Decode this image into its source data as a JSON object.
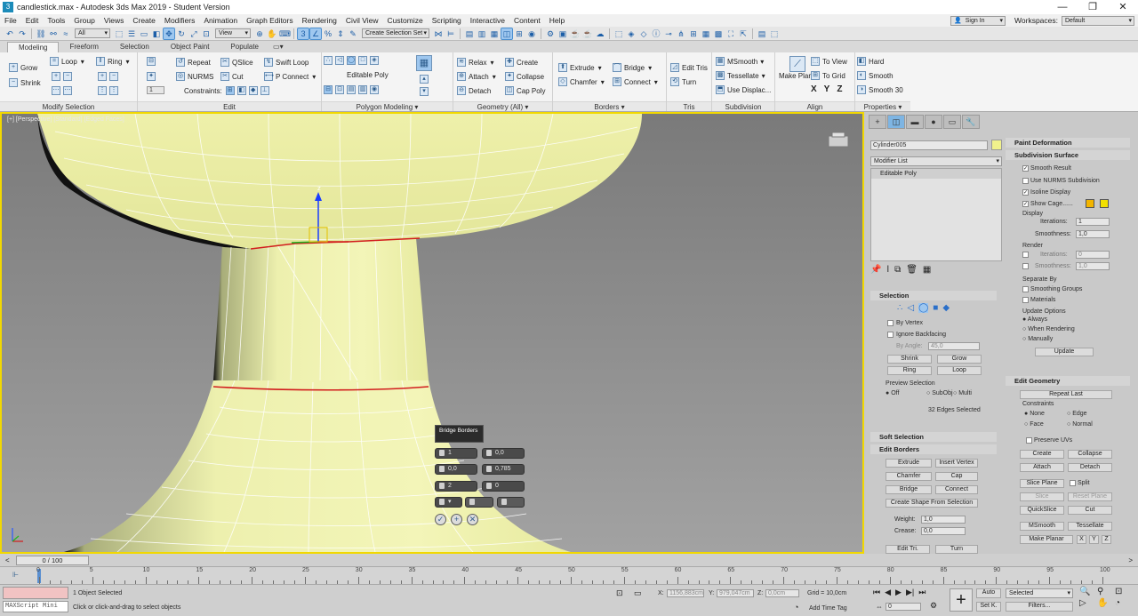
{
  "title": {
    "app": "candlestick.max - Autodesk 3ds Max 2019 - Student Version",
    "controls": [
      "—",
      "❐",
      "✕"
    ]
  },
  "menu": [
    "File",
    "Edit",
    "Tools",
    "Group",
    "Views",
    "Create",
    "Modifiers",
    "Animation",
    "Graph Editors",
    "Rendering",
    "Civil View",
    "Customize",
    "Scripting",
    "Interactive",
    "Content",
    "Help"
  ],
  "account": {
    "sign_in": "Sign In",
    "workspaces_label": "Workspaces:",
    "workspace": "Default"
  },
  "toolbar": {
    "filter": "All",
    "coord": "View",
    "selection_set": "Create Selection Set"
  },
  "ribbon_tabs": [
    "Modeling",
    "Freeform",
    "Selection",
    "Object Paint",
    "Populate"
  ],
  "ribbon": {
    "modify_selection": {
      "title": "Modify Selection",
      "grow": "Grow",
      "shrink": "Shrink",
      "loop": "Loop",
      "ring": "Ring"
    },
    "edit": {
      "title": "Edit",
      "repeat": "Repeat",
      "qslice": "QSlice",
      "swift_loop": "Swift Loop",
      "nurms": "NURMS",
      "cut": "Cut",
      "p_connect": "P Connect",
      "constraints": "Constraints:",
      "spin_value": "1"
    },
    "polygon_modeling": {
      "title": "Polygon Modeling",
      "editable_poly": "Editable Poly"
    },
    "geometry": {
      "title": "Geometry (All)",
      "relax": "Relax",
      "create": "Create",
      "attach": "Attach",
      "collapse": "Collapse",
      "detach": "Detach",
      "cap_poly": "Cap Poly"
    },
    "borders": {
      "title": "Borders",
      "extrude": "Extrude",
      "bridge": "Bridge",
      "chamfer": "Chamfer",
      "connect": "Connect"
    },
    "tris": {
      "title": "Tris",
      "edit_tris": "Edit Tris",
      "turn": "Turn"
    },
    "subdivision": {
      "title": "Subdivision",
      "msmooth": "MSmooth",
      "tessellate": "Tessellate",
      "use_displac": "Use Displac..."
    },
    "align": {
      "title": "Align",
      "make_planar": "Make Planar",
      "to_view": "To View",
      "to_grid": "To Grid",
      "x": "X",
      "y": "Y",
      "z": "Z"
    },
    "properties": {
      "title": "Properties",
      "hard": "Hard",
      "smooth": "Smooth",
      "smooth30": "Smooth 30"
    }
  },
  "viewport": {
    "label": "[+] [Perspective] [Standard] [Edged Faces]"
  },
  "caddy": {
    "title": "Bridge Borders",
    "segments": "1",
    "taper": "0,0",
    "bias": "0,0",
    "smooth": "0,785",
    "twist1": "2",
    "twist2": "0"
  },
  "command_panel": {
    "object_name": "Cylinder005",
    "modifier_list": "Modifier List",
    "stack_item": "Editable Poly",
    "selection": {
      "title": "Selection",
      "by_vertex": "By Vertex",
      "ignore_backfacing": "Ignore Backfacing",
      "by_angle": "By Angle:",
      "angle_value": "45,0",
      "shrink": "Shrink",
      "grow": "Grow",
      "ring": "Ring",
      "loop": "Loop",
      "preview": "Preview Selection",
      "off": "Off",
      "subobj": "SubObj",
      "multi": "Multi",
      "status": "32 Edges Selected"
    },
    "soft_selection": "Soft Selection",
    "edit_borders": {
      "title": "Edit Borders",
      "extrude": "Extrude",
      "insert_vertex": "Insert Vertex",
      "chamfer": "Chamfer",
      "cap": "Cap",
      "bridge": "Bridge",
      "connect": "Connect",
      "create_shape": "Create Shape From Selection",
      "weight": "Weight:",
      "weight_value": "1,0",
      "crease": "Crease:",
      "crease_value": "0,0",
      "edit_tri": "Edit Tri.",
      "turn": "Turn"
    },
    "paint_deformation": "Paint Deformation",
    "subdivision_surface": {
      "title": "Subdivision Surface",
      "smooth_result": "Smooth Result",
      "use_nurms": "Use NURMS Subdivision",
      "isoline": "Isoline Display",
      "show_cage": "Show Cage......",
      "display": "Display",
      "iterations": "Iterations:",
      "iter_value": "1",
      "smoothness": "Smoothness:",
      "smooth_value": "1,0",
      "render": "Render",
      "r_iter_value": "0",
      "r_smooth_value": "1,0",
      "separate_by": "Separate By",
      "smoothing_groups": "Smoothing Groups",
      "materials": "Materials",
      "update_options": "Update Options",
      "always": "Always",
      "when_rendering": "When Rendering",
      "manually": "Manually",
      "update": "Update"
    },
    "edit_geometry": {
      "title": "Edit Geometry",
      "repeat_last": "Repeat Last",
      "constraints": "Constraints",
      "none": "None",
      "edge": "Edge",
      "face": "Face",
      "normal": "Normal",
      "preserve_uvs": "Preserve UVs",
      "create": "Create",
      "collapse": "Collapse",
      "attach": "Attach",
      "detach": "Detach",
      "slice_plane": "Slice Plane",
      "split": "Split",
      "slice": "Slice",
      "reset_plane": "Reset Plane",
      "quickslice": "QuickSlice",
      "cut": "Cut",
      "msmooth": "MSmooth",
      "tessellate": "Tessellate",
      "make_planar": "Make Planar",
      "x": "X",
      "y": "Y",
      "z": "Z"
    }
  },
  "timeline": {
    "frame": "0 / 100",
    "ticks": [
      "0",
      "5",
      "10",
      "15",
      "20",
      "25",
      "30",
      "35",
      "40",
      "45",
      "50",
      "55",
      "60",
      "65",
      "70",
      "75",
      "80",
      "85",
      "90",
      "95",
      "100"
    ]
  },
  "status": {
    "maxscript": "MAXScript Mini",
    "objects": "1 Object Selected",
    "hint": "Click or click-and-drag to select objects",
    "x_label": "X:",
    "x": "1156,883cm",
    "y_label": "Y:",
    "y": "979,047cm",
    "z_label": "Z:",
    "z": "0,0cm",
    "grid": "Grid = 10,0cm",
    "add_time_tag": "Add Time Tag",
    "auto": "Auto",
    "selected": "Selected",
    "set_key": "Set K.",
    "filters": "Filters...",
    "frame_field": "0"
  }
}
